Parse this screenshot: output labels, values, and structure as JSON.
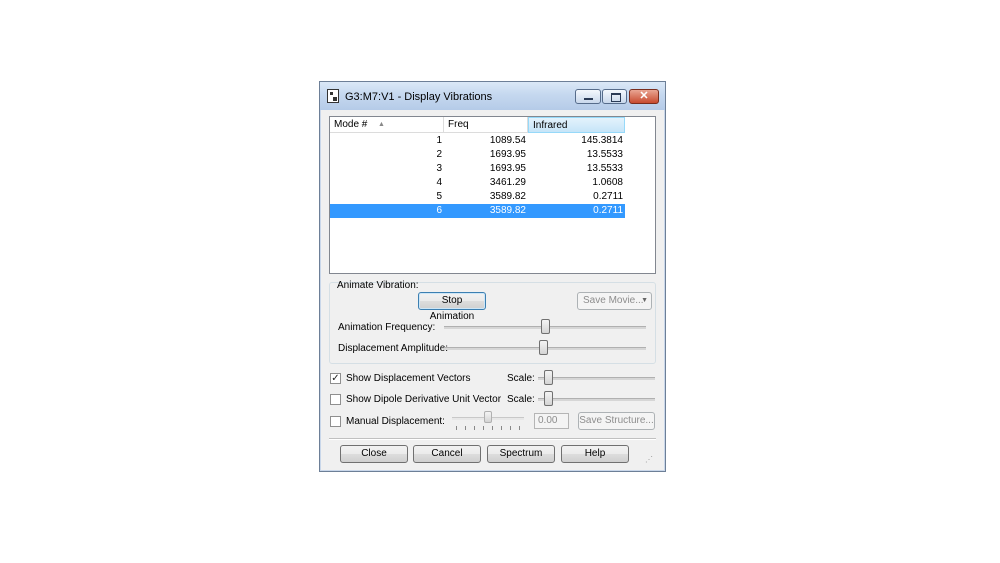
{
  "window": {
    "title": "G3:M7:V1 - Display Vibrations",
    "close_glyph": "✕"
  },
  "table": {
    "headers": {
      "mode": "Mode #",
      "freq": "Freq",
      "infrared": "Infrared"
    },
    "rows": [
      {
        "mode": "1",
        "freq": "1089.54",
        "infrared": "145.3814"
      },
      {
        "mode": "2",
        "freq": "1693.95",
        "infrared": "13.5533"
      },
      {
        "mode": "3",
        "freq": "1693.95",
        "infrared": "13.5533"
      },
      {
        "mode": "4",
        "freq": "3461.29",
        "infrared": "1.0608"
      },
      {
        "mode": "5",
        "freq": "3589.82",
        "infrared": "0.2711"
      },
      {
        "mode": "6",
        "freq": "3589.82",
        "infrared": "0.2711"
      }
    ],
    "selected_row": 6
  },
  "animate": {
    "group_label": "Animate Vibration:",
    "stop_label": "Stop Animation",
    "save_movie_label": "Save Movie...",
    "frequency_label": "Animation Frequency:",
    "frequency_value": 0.5,
    "amplitude_label": "Displacement Amplitude:",
    "amplitude_value": 0.49
  },
  "options": {
    "vectors_label": "Show Displacement Vectors",
    "vectors_checked": true,
    "vectors_scale_label": "Scale:",
    "vectors_scale_value": 0.06,
    "dipole_label": "Show Dipole Derivative Unit Vector",
    "dipole_checked": false,
    "dipole_scale_label": "Scale:",
    "dipole_scale_value": 0.06,
    "manual_label": "Manual Displacement:",
    "manual_checked": false,
    "manual_value": "0.00",
    "manual_slider_value": 0.5,
    "save_structure_label": "Save Structure..."
  },
  "buttons": {
    "close": "Close",
    "cancel": "Cancel",
    "spectrum": "Spectrum",
    "help": "Help"
  },
  "colors": {
    "selection": "#3399ff",
    "title_gradient_top": "#dbe8f7",
    "close_button": "#c84a2f"
  }
}
